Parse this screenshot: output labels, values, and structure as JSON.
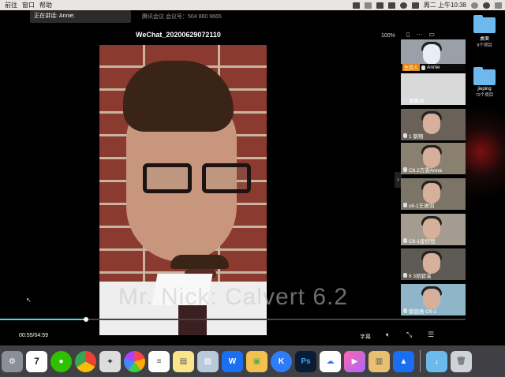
{
  "menubar": {
    "items": [
      "前往",
      "窗口",
      "帮助"
    ],
    "clock": "周二 上午10:38"
  },
  "meeting": {
    "speaking_label": "正在讲话: Annie;",
    "meeting_id_label": "腾讯会议 会议号：504 860 9665",
    "video_title": "WeChat_20200629072110",
    "zoom_level": "100%",
    "watermark_text": "Mr. Nick: Calvert 6.2",
    "elapsed": "00:55",
    "duration": "04:59",
    "time_display": "00:55/04:59",
    "progress_fraction": 0.184,
    "subtitle_label": "字幕"
  },
  "participants": [
    {
      "name": "Annie",
      "host_badge": "主持人"
    },
    {
      "name": "张晨卓"
    },
    {
      "name": "1 蔡翔"
    },
    {
      "name": "C6.2方雯Anna"
    },
    {
      "name": "c6-1王语羽"
    },
    {
      "name": "C6-1金欣恒"
    },
    {
      "name": "6 3胡碧溪"
    },
    {
      "name": "蔡悠扬 C6-1"
    }
  ],
  "desktop": {
    "folders": [
      {
        "name": "桌面",
        "count": "9个项目"
      },
      {
        "name": "jieping",
        "count": "72个项目"
      }
    ]
  },
  "dock": {
    "icons": [
      "finder-icon",
      "calendar-icon",
      "wechat-icon",
      "chrome-icon",
      "screenshot-icon",
      "photos-icon",
      "reminders-icon",
      "notes-icon",
      "preview-icon",
      "wps-icon",
      "contacts-icon",
      "klack-icon",
      "photoshop-icon",
      "baidu-netdisk-icon",
      "final-cut-icon",
      "archive-icon",
      "tencent-meeting-icon",
      "downloads-folder-icon",
      "trash-icon"
    ],
    "calendar_day": "7",
    "ps_label": "Ps",
    "k_label": "K",
    "w_label": "W"
  },
  "colors": {
    "accent_progress": "#4fd4e8",
    "host_badge": "#e58a16",
    "folder_blue": "#6cb9ee"
  }
}
